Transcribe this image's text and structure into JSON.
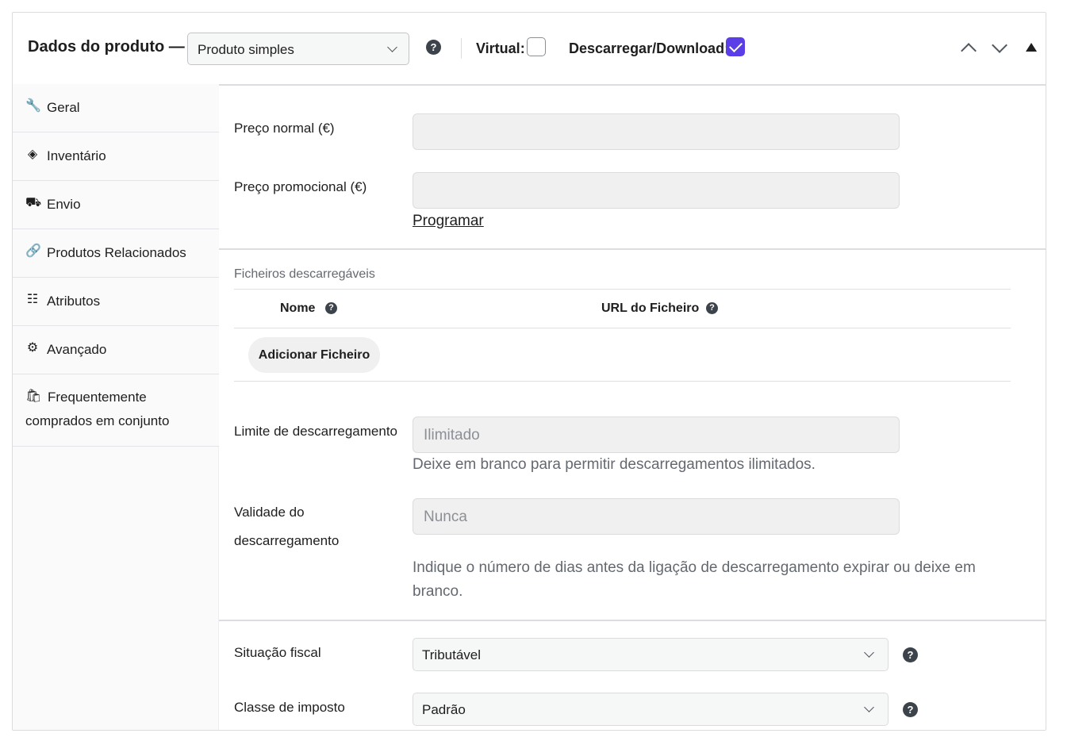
{
  "header": {
    "title": "Dados do produto —",
    "product_type": "Produto simples",
    "virtual_label": "Virtual:",
    "virtual_checked": false,
    "download_label": "Descarregar/Download:",
    "download_checked": true,
    "help_glyph": "?"
  },
  "sidebar": {
    "tabs": [
      {
        "label": "Geral",
        "icon": "wrench-icon",
        "glyph": "🔧"
      },
      {
        "label": "Inventário",
        "icon": "tag-icon",
        "glyph": "◈"
      },
      {
        "label": "Envio",
        "icon": "truck-icon",
        "glyph": "⛟"
      },
      {
        "label": "Produtos Relacionados",
        "icon": "link-icon",
        "glyph": "🔗"
      },
      {
        "label": "Atributos",
        "icon": "list-icon",
        "glyph": "☷"
      },
      {
        "label": "Avançado",
        "icon": "gear-icon",
        "glyph": "⚙"
      },
      {
        "label": "Frequentemente comprados em conjunto",
        "icon": "bag-icon",
        "glyph": "🛍"
      }
    ]
  },
  "general": {
    "regular_price_label": "Preço normal (€)",
    "regular_price_value": "",
    "sale_price_label": "Preço promocional (€)",
    "sale_price_value": "",
    "schedule_link": "Programar"
  },
  "downloads": {
    "section_title": "Ficheiros descarregáveis",
    "col_name": "Nome",
    "col_url": "URL do Ficheiro",
    "add_file_button": "Adicionar Ficheiro",
    "limit_label": "Limite de descarregamento",
    "limit_placeholder": "Ilimitado",
    "limit_desc": "Deixe em branco para permitir descarregamentos ilimitados.",
    "expiry_label": "Validade do descarregamento",
    "expiry_placeholder": "Nunca",
    "expiry_desc": "Indique o número de dias antes da ligação de descarregamento expirar ou deixe em branco."
  },
  "tax": {
    "status_label": "Situação fiscal",
    "status_value": "Tributável",
    "class_label": "Classe de imposto",
    "class_value": "Padrão"
  },
  "colors": {
    "accent": "#5b3ee8",
    "border": "#dcdcde",
    "input_bg": "#f0f0f1",
    "muted_text": "#646970"
  }
}
